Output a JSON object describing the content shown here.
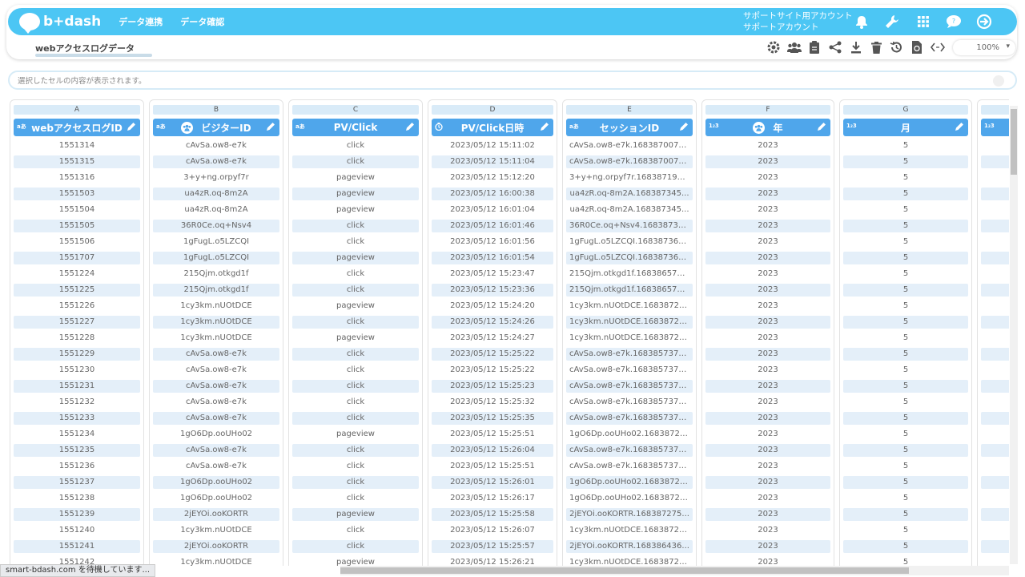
{
  "app": {
    "logo_text": "b+dash",
    "nav": [
      "データ連携",
      "データ確認"
    ],
    "account_line1": "サポートサイト用アカウント",
    "account_line2": "サポートアカウント"
  },
  "header_icons": [
    "bell-icon",
    "wrench-icon",
    "grid-apps-icon",
    "help-chat-icon",
    "logout-icon"
  ],
  "tab": {
    "title": "webアクセスログデータ"
  },
  "toolbar": {
    "icons": [
      "settings-icon",
      "users-icon",
      "clipboard-icon",
      "share-icon",
      "download-icon",
      "trash-icon",
      "history-icon",
      "refresh-doc-icon",
      "code-icon"
    ],
    "zoom": "100%"
  },
  "cellbar": {
    "placeholder": "選択したセルの内容が表示されます。"
  },
  "columns": [
    {
      "letter": "A",
      "name": "webアクセスログID",
      "type": "aあ",
      "icon": ""
    },
    {
      "letter": "B",
      "name": "ビジターID",
      "type": "aあ",
      "icon": "users"
    },
    {
      "letter": "C",
      "name": "PV/Click",
      "type": "aあ",
      "icon": ""
    },
    {
      "letter": "D",
      "name": "PV/Click日時",
      "type": "clock",
      "icon": ""
    },
    {
      "letter": "E",
      "name": "セッションID",
      "type": "aあ",
      "icon": ""
    },
    {
      "letter": "F",
      "name": "年",
      "type": "1₂3",
      "icon": "users"
    },
    {
      "letter": "G",
      "name": "月",
      "type": "1₂3",
      "icon": ""
    }
  ],
  "rows": [
    [
      "1551314",
      "cAvSa.ow8-e7k",
      "click",
      "2023/05/12 15:11:02",
      "cAvSa.ow8-e7k.1683870076...",
      "2023",
      "5"
    ],
    [
      "1551315",
      "cAvSa.ow8-e7k",
      "click",
      "2023/05/12 15:11:04",
      "cAvSa.ow8-e7k.1683870076...",
      "2023",
      "5"
    ],
    [
      "1551316",
      "3+y+ng.orpyf7r",
      "pageview",
      "2023/05/12 15:12:20",
      "3+y+ng.orpyf7r.168387193...",
      "2023",
      "5"
    ],
    [
      "1551503",
      "ua4zR.oq-8m2A",
      "pageview",
      "2023/05/12 16:00:38",
      "ua4zR.oq-8m2A.168387345...",
      "2023",
      "5"
    ],
    [
      "1551504",
      "ua4zR.oq-8m2A",
      "pageview",
      "2023/05/12 16:01:04",
      "ua4zR.oq-8m2A.168387345...",
      "2023",
      "5"
    ],
    [
      "1551505",
      "36R0Ce.oq+Nsv4",
      "click",
      "2023/05/12 16:01:46",
      "36R0Ce.oq+Nsv4.16838736...",
      "2023",
      "5"
    ],
    [
      "1551506",
      "1gFugL.o5LZCQI",
      "click",
      "2023/05/12 16:01:56",
      "1gFugL.o5LZCQI.168387367...",
      "2023",
      "5"
    ],
    [
      "1551707",
      "1gFugL.o5LZCQI",
      "pageview",
      "2023/05/12 16:01:54",
      "1gFugL.o5LZCQI.168387367...",
      "2023",
      "5"
    ],
    [
      "1551224",
      "215Qjm.otkgd1f",
      "click",
      "2023/05/12 15:23:47",
      "215Qjm.otkgd1f.168386573...",
      "2023",
      "5"
    ],
    [
      "1551225",
      "215Qjm.otkgd1f",
      "click",
      "2023/05/12 15:23:36",
      "215Qjm.otkgd1f.168386573...",
      "2023",
      "5"
    ],
    [
      "1551226",
      "1cy3km.nUOtDCE",
      "pageview",
      "2023/05/12 15:24:20",
      "1cy3km.nUOtDCE.16838726...",
      "2023",
      "5"
    ],
    [
      "1551227",
      "1cy3km.nUOtDCE",
      "click",
      "2023/05/12 15:24:26",
      "1cy3km.nUOtDCE.16838726...",
      "2023",
      "5"
    ],
    [
      "1551228",
      "1cy3km.nUOtDCE",
      "pageview",
      "2023/05/12 15:24:27",
      "1cy3km.nUOtDCE.16838726...",
      "2023",
      "5"
    ],
    [
      "1551229",
      "cAvSa.ow8-e7k",
      "click",
      "2023/05/12 15:25:22",
      "cAvSa.ow8-e7k.1683857376...",
      "2023",
      "5"
    ],
    [
      "1551230",
      "cAvSa.ow8-e7k",
      "click",
      "2023/05/12 15:25:22",
      "cAvSa.ow8-e7k.1683857376...",
      "2023",
      "5"
    ],
    [
      "1551231",
      "cAvSa.ow8-e7k",
      "click",
      "2023/05/12 15:25:23",
      "cAvSa.ow8-e7k.1683857376...",
      "2023",
      "5"
    ],
    [
      "1551232",
      "cAvSa.ow8-e7k",
      "click",
      "2023/05/12 15:25:32",
      "cAvSa.ow8-e7k.1683857376...",
      "2023",
      "5"
    ],
    [
      "1551233",
      "cAvSa.ow8-e7k",
      "click",
      "2023/05/12 15:25:35",
      "cAvSa.ow8-e7k.1683857376...",
      "2023",
      "5"
    ],
    [
      "1551234",
      "1gO6Dp.ooUHo02",
      "pageview",
      "2023/05/12 15:25:51",
      "1gO6Dp.ooUHo02.16838727...",
      "2023",
      "5"
    ],
    [
      "1551235",
      "cAvSa.ow8-e7k",
      "click",
      "2023/05/12 15:26:04",
      "cAvSa.ow8-e7k.1683857376...",
      "2023",
      "5"
    ],
    [
      "1551236",
      "cAvSa.ow8-e7k",
      "click",
      "2023/05/12 15:25:51",
      "cAvSa.ow8-e7k.1683857376...",
      "2023",
      "5"
    ],
    [
      "1551237",
      "1gO6Dp.ooUHo02",
      "click",
      "2023/05/12 15:26:01",
      "1gO6Dp.ooUHo02.16838727...",
      "2023",
      "5"
    ],
    [
      "1551238",
      "1gO6Dp.ooUHo02",
      "click",
      "2023/05/12 15:26:17",
      "1gO6Dp.ooUHo02.16838727...",
      "2023",
      "5"
    ],
    [
      "1551239",
      "2jEYOi.ooKORTR",
      "pageview",
      "2023/05/12 15:25:58",
      "2jEYOi.ooKORTR.168387275...",
      "2023",
      "5"
    ],
    [
      "1551240",
      "1cy3km.nUOtDCE",
      "click",
      "2023/05/12 15:26:07",
      "1cy3km.nUOtDCE.16838726...",
      "2023",
      "5"
    ],
    [
      "1551241",
      "2jEYOi.ooKORTR",
      "click",
      "2023/05/12 15:25:57",
      "2jEYOi.ooKORTR.168386436...",
      "2023",
      "5"
    ],
    [
      "1551242",
      "1cy3km.nUOtDCE",
      "pageview",
      "2023/05/12 15:26:21",
      "1cy3km.nUOtDCE.16838726...",
      "2023",
      "5"
    ]
  ],
  "next_column": {
    "type": "1₂3"
  },
  "status_text": "smart-bdash.com を待機しています...",
  "colors": {
    "brand": "#4cc6f4",
    "header": "#4fa6eb",
    "row_alt": "#e4eff9"
  }
}
